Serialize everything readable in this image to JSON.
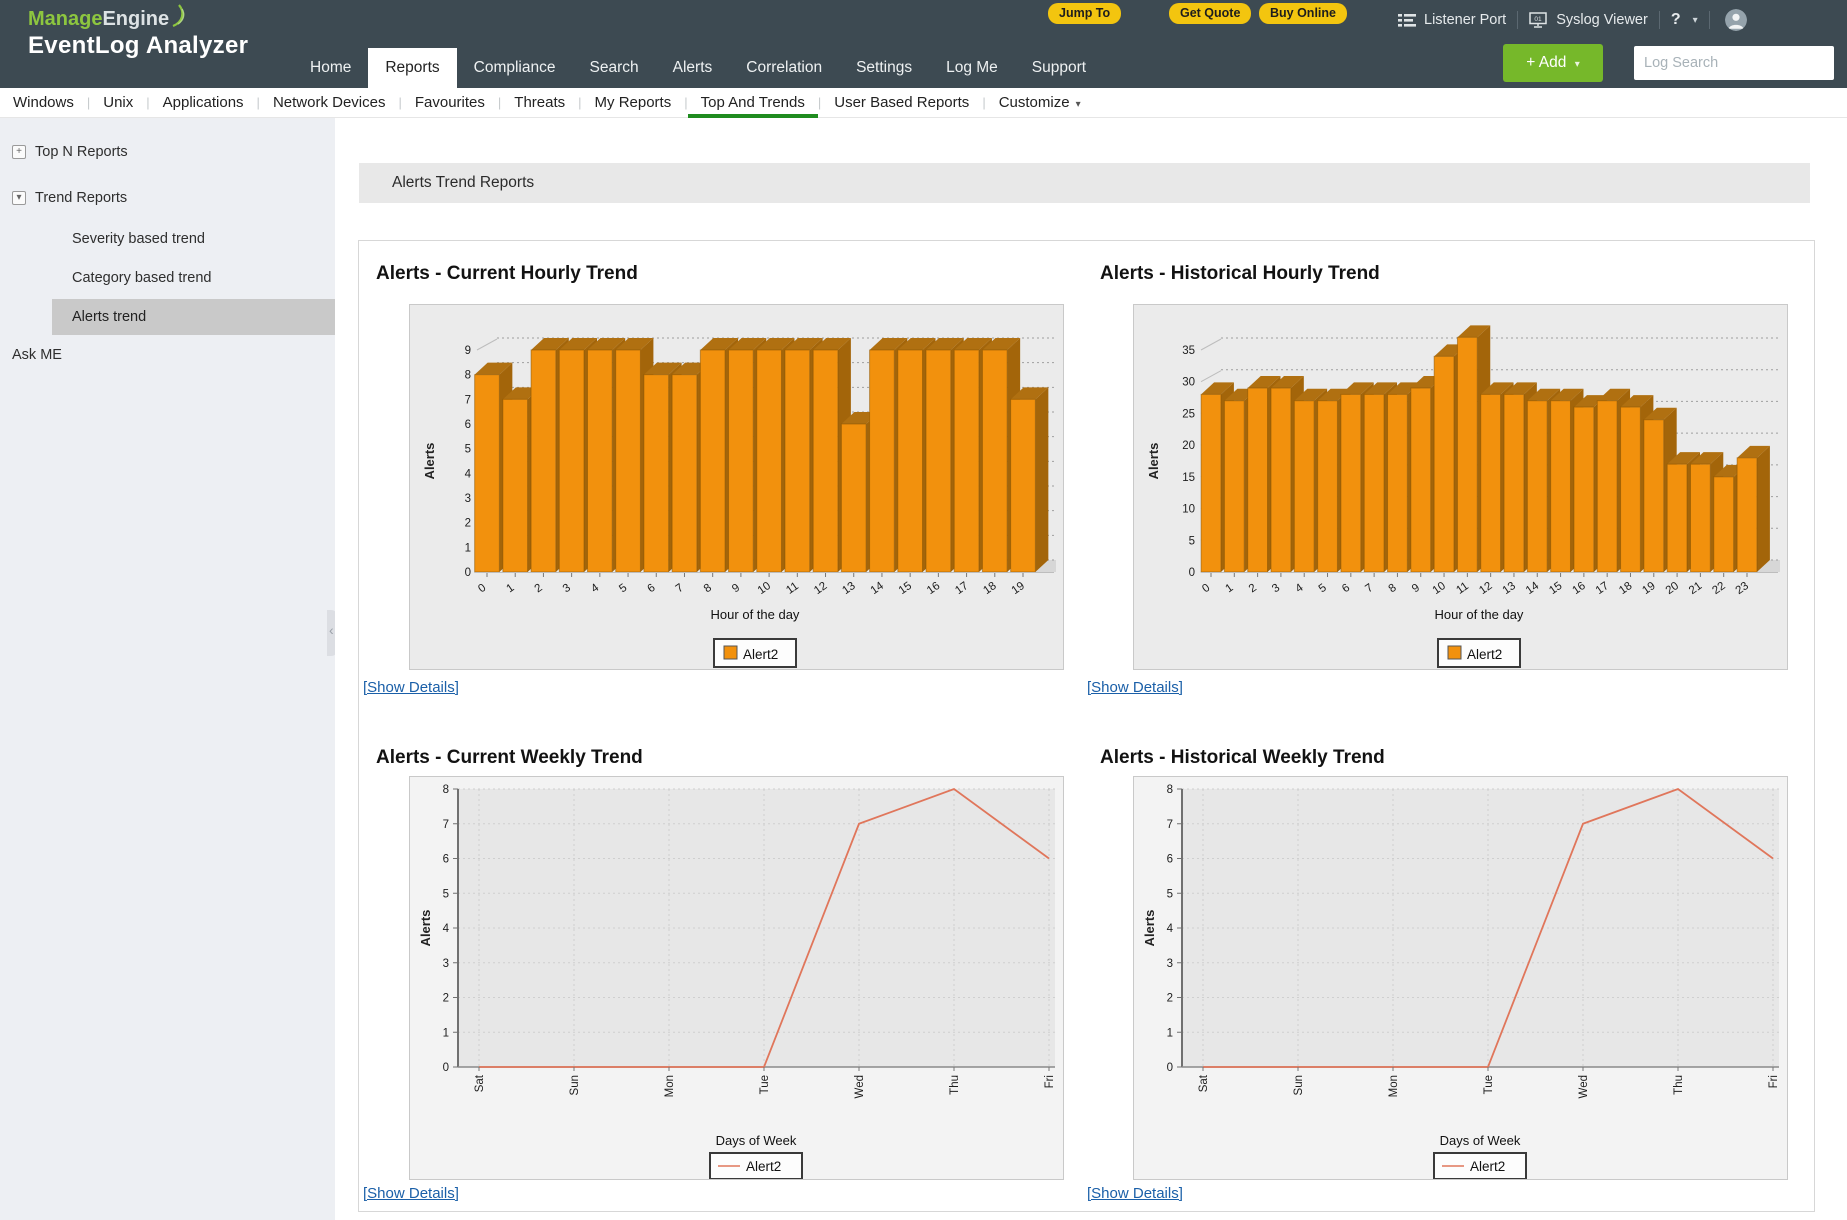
{
  "topbar": {
    "logo": {
      "brand_green": "Manage",
      "brand_rest": "Engine",
      "product": "EventLog Analyzer"
    },
    "promo_buttons": [
      "Jump To",
      "Get Quote",
      "Buy Online"
    ],
    "utility": {
      "listener_port": "Listener Port",
      "syslog_viewer": "Syslog Viewer",
      "help": "?"
    },
    "nav": [
      {
        "label": "Home"
      },
      {
        "label": "Reports",
        "active": true
      },
      {
        "label": "Compliance"
      },
      {
        "label": "Search"
      },
      {
        "label": "Alerts"
      },
      {
        "label": "Correlation"
      },
      {
        "label": "Settings"
      },
      {
        "label": "Log Me"
      },
      {
        "label": "Support"
      }
    ],
    "add_label": "+ Add",
    "search_placeholder": "Log Search"
  },
  "subnav": {
    "items": [
      {
        "label": "Windows"
      },
      {
        "label": "Unix"
      },
      {
        "label": "Applications"
      },
      {
        "label": "Network Devices"
      },
      {
        "label": "Favourites"
      },
      {
        "label": "Threats"
      },
      {
        "label": "My Reports"
      },
      {
        "label": "Top And Trends",
        "active": true
      },
      {
        "label": "User Based Reports"
      }
    ],
    "customize_label": "Customize"
  },
  "sidebar": {
    "items": [
      {
        "label": "Top N Reports",
        "type": "group-collapsed"
      },
      {
        "label": "Trend Reports",
        "type": "group-expanded"
      },
      {
        "label": "Severity based trend",
        "type": "child"
      },
      {
        "label": "Category based trend",
        "type": "child"
      },
      {
        "label": "Alerts trend",
        "type": "child",
        "selected": true
      },
      {
        "label": "Ask ME",
        "type": "root"
      }
    ]
  },
  "main": {
    "page_title": "Alerts Trend Reports",
    "show_details_label": "[Show Details]"
  },
  "icons": {
    "caret_down": "▾",
    "expand": "+",
    "collapse": "▾"
  },
  "colors": {
    "topbar_bg": "#3d4a52",
    "promo_yellow": "#f3c50f",
    "accent_green": "#76b82a",
    "active_underline_green": "#1f8c1f",
    "link_blue": "#1a5fa8",
    "bar_front": "#f2910d",
    "bar_top": "#b07011",
    "bar_side": "#a3650a",
    "line_series": "#e0765b",
    "sidebar_selected_bg": "#c9c9c9"
  },
  "chart_data": [
    {
      "type": "bar",
      "title": "Alerts - Current Hourly Trend",
      "xlabel": "Hour of the day",
      "ylabel": "Alerts",
      "categories": [
        "0",
        "1",
        "2",
        "3",
        "4",
        "5",
        "6",
        "7",
        "8",
        "9",
        "10",
        "11",
        "12",
        "13",
        "14",
        "15",
        "16",
        "17",
        "18",
        "19"
      ],
      "values": [
        8,
        7,
        9,
        9,
        9,
        9,
        8,
        8,
        9,
        9,
        9,
        9,
        9,
        6,
        9,
        9,
        9,
        9,
        9,
        7
      ],
      "yticks": [
        0,
        1,
        2,
        3,
        4,
        5,
        6,
        7,
        8,
        9
      ],
      "ylim": [
        0,
        9.9
      ],
      "grid": "dashed-horizontal",
      "legend": [
        "Alert2"
      ],
      "legend_position": "bottom"
    },
    {
      "type": "bar",
      "title": "Alerts - Historical Hourly Trend",
      "xlabel": "Hour of the day",
      "ylabel": "Alerts",
      "categories": [
        "0",
        "1",
        "2",
        "3",
        "4",
        "5",
        "6",
        "7",
        "8",
        "9",
        "10",
        "11",
        "12",
        "13",
        "14",
        "15",
        "16",
        "17",
        "18",
        "19",
        "20",
        "21",
        "22",
        "23"
      ],
      "values": [
        28,
        27,
        29,
        29,
        27,
        27,
        28,
        28,
        28,
        29,
        34,
        37,
        28,
        28,
        27,
        27,
        26,
        27,
        26,
        24,
        17,
        17,
        15,
        18
      ],
      "yticks": [
        0,
        5,
        10,
        15,
        20,
        25,
        30,
        35
      ],
      "ylim": [
        0,
        38.5
      ],
      "grid": "dashed-horizontal",
      "legend": [
        "Alert2"
      ],
      "legend_position": "bottom"
    },
    {
      "type": "line",
      "title": "Alerts - Current Weekly Trend",
      "xlabel": "Days of Week",
      "ylabel": "Alerts",
      "categories": [
        "Sat",
        "Sun",
        "Mon",
        "Tue",
        "Wed",
        "Thu",
        "Fri"
      ],
      "values": [
        0,
        0,
        0,
        0,
        7,
        8,
        6
      ],
      "yticks": [
        0,
        1,
        2,
        3,
        4,
        5,
        6,
        7,
        8
      ],
      "ylim": [
        0,
        8.5
      ],
      "grid": "dotted-both",
      "legend": [
        "Alert2"
      ],
      "legend_position": "bottom"
    },
    {
      "type": "line",
      "title": "Alerts - Historical Weekly Trend",
      "xlabel": "Days of Week",
      "ylabel": "Alerts",
      "categories": [
        "Sat",
        "Sun",
        "Mon",
        "Tue",
        "Wed",
        "Thu",
        "Fri"
      ],
      "values": [
        0,
        0,
        0,
        0,
        7,
        8,
        6
      ],
      "yticks": [
        0,
        1,
        2,
        3,
        4,
        5,
        6,
        7,
        8
      ],
      "ylim": [
        0,
        8.5
      ],
      "grid": "dotted-both",
      "legend": [
        "Alert2"
      ],
      "legend_position": "bottom"
    }
  ]
}
